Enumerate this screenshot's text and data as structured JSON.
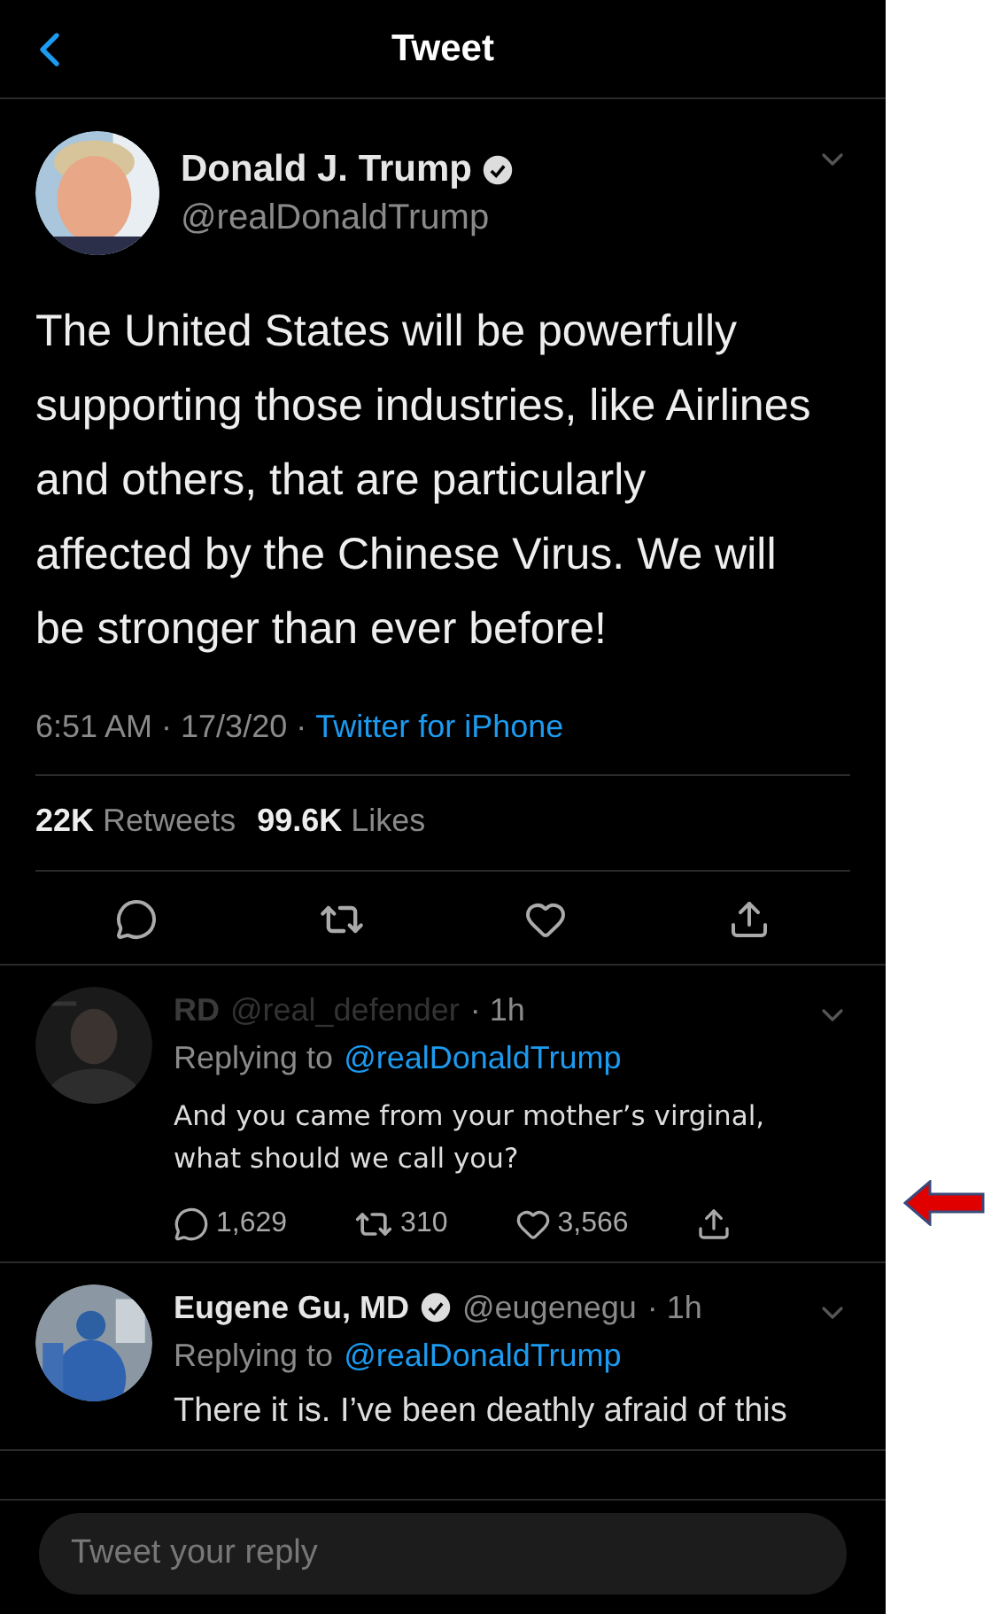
{
  "header": {
    "title": "Tweet"
  },
  "tweet": {
    "name": "Donald J. Trump",
    "verified": true,
    "handle": "@realDonaldTrump",
    "text": "The United States will be powerfully supporting those industries, like Airlines and others, that are particularly affected by the Chinese Virus. We will be stronger than ever before!",
    "timestamp": "6:51 AM · 17/3/20 ·",
    "source": "Twitter for iPhone",
    "retweets": "22K",
    "retweets_label": "Retweets",
    "likes": "99.6K",
    "likes_label": "Likes"
  },
  "replies": [
    {
      "name": "RD",
      "verified": false,
      "dimmed": true,
      "handle": "@real_defender",
      "age": "· 1h",
      "replying_label": "Replying to",
      "replying_to": "@realDonaldTrump",
      "text": "And you came from your mother’s virginal, what should we call you?",
      "reply_count": "1,629",
      "retweet_count": "310",
      "like_count": "3,566"
    },
    {
      "name": "Eugene Gu, MD",
      "verified": true,
      "dimmed": false,
      "handle": "@eugenegu",
      "age": "· 1h",
      "replying_label": "Replying to",
      "replying_to": "@realDonaldTrump",
      "text": "There it is. I’ve been deathly afraid of this"
    }
  ],
  "composer": {
    "placeholder": "Tweet your reply"
  }
}
